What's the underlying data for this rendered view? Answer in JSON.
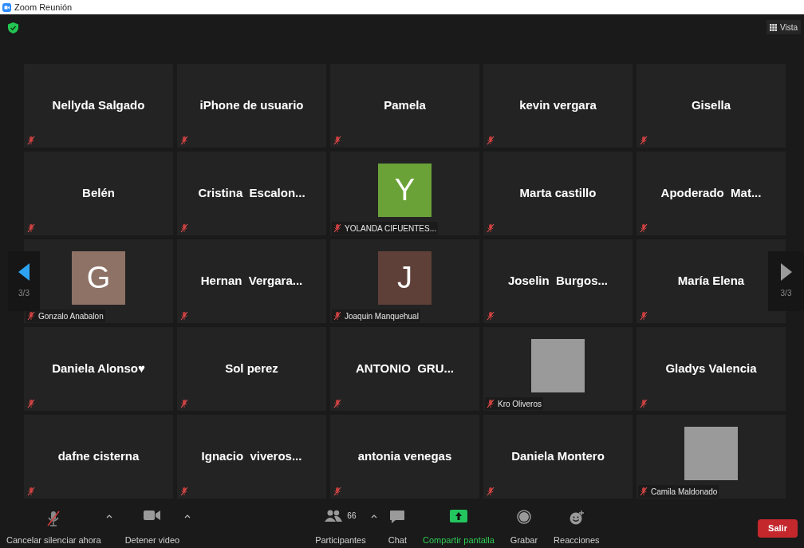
{
  "window": {
    "title": "Zoom Reunión"
  },
  "view_button": {
    "label": "Vista"
  },
  "pager": {
    "previous": {
      "label": "3/3"
    },
    "next": {
      "label": "3/3"
    }
  },
  "tiles": [
    {
      "kind": "name",
      "name": "Nellyda Salgado",
      "muted": true
    },
    {
      "kind": "name",
      "name": "iPhone de usuario",
      "muted": true
    },
    {
      "kind": "name",
      "name": "Pamela",
      "muted": true
    },
    {
      "kind": "name",
      "name": "kevin vergara",
      "muted": true
    },
    {
      "kind": "name",
      "name": "Gisella",
      "muted": true
    },
    {
      "kind": "name",
      "name": "Belén",
      "muted": true
    },
    {
      "kind": "name",
      "name": "Cristina  Escalon...",
      "muted": true
    },
    {
      "kind": "initial",
      "initial": "Y",
      "color": "#6aa238",
      "name": "YOLANDA CIFUENTES...",
      "muted": true
    },
    {
      "kind": "name",
      "name": "Marta castillo",
      "muted": true
    },
    {
      "kind": "name",
      "name": "Apoderado  Mat...",
      "muted": true
    },
    {
      "kind": "initial",
      "initial": "G",
      "color": "#8e7266",
      "name": "Gonzalo Anabalon",
      "muted": true
    },
    {
      "kind": "name",
      "name": "Hernan  Vergara...",
      "muted": true
    },
    {
      "kind": "initial",
      "initial": "J",
      "color": "#5e4038",
      "name": "Joaquin Manquehual",
      "muted": true
    },
    {
      "kind": "name",
      "name": "Joselin  Burgos...",
      "muted": true
    },
    {
      "kind": "name",
      "name": "María Elena",
      "muted": true
    },
    {
      "kind": "name",
      "name": "Daniela Alonso♥",
      "muted": true
    },
    {
      "kind": "name",
      "name": "Sol perez",
      "muted": true
    },
    {
      "kind": "name",
      "name": "ANTONIO  GRU...",
      "muted": true
    },
    {
      "kind": "photo",
      "name": "Kro Oliveros",
      "muted": true
    },
    {
      "kind": "name",
      "name": "Gladys Valencia",
      "muted": true
    },
    {
      "kind": "name",
      "name": "dafne cisterna",
      "muted": true
    },
    {
      "kind": "name",
      "name": "Ignacio  viveros...",
      "muted": true
    },
    {
      "kind": "name",
      "name": "antonia venegas",
      "muted": true
    },
    {
      "kind": "name",
      "name": "Daniela Montero",
      "muted": true
    },
    {
      "kind": "photo",
      "name": "Camila Maldonado",
      "muted": true
    }
  ],
  "toolbar": [
    {
      "kind": "mic",
      "label": "Cancelar silenciar ahora",
      "has_menu": true
    },
    {
      "kind": "video",
      "label": "Detener video",
      "has_menu": true
    },
    {
      "kind": "participants",
      "label": "Participantes",
      "count": "66",
      "has_menu": true
    },
    {
      "kind": "chat",
      "label": "Chat",
      "has_menu": false
    },
    {
      "kind": "share",
      "label": "Compartir pantalla",
      "has_menu": false
    },
    {
      "kind": "record",
      "label": "Grabar",
      "has_menu": false
    },
    {
      "kind": "reactions",
      "label": "Reacciones",
      "has_menu": false
    }
  ],
  "leave_button": {
    "label": "Salir"
  }
}
